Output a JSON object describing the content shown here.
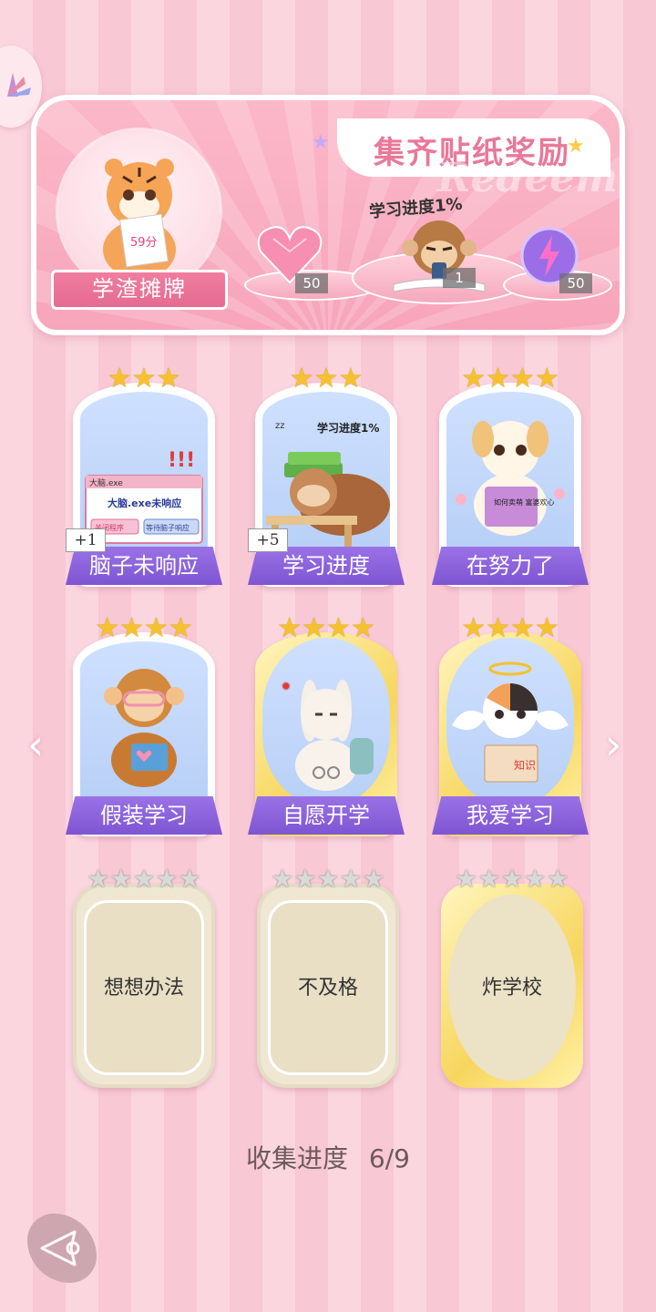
{
  "banner": {
    "title": "集齐贴纸奖励",
    "watermark": "Redeem",
    "ribbon_label": "学渣摊牌",
    "tiger_sign": "59分",
    "progress_tag": "学习进度1%",
    "rewards": [
      {
        "name": "heart-gem",
        "count": "50"
      },
      {
        "name": "monkey-sticker",
        "count": "1"
      },
      {
        "name": "lightning-orb",
        "count": "50"
      }
    ]
  },
  "cards": [
    {
      "label": "脑子未响应",
      "stars": "★★★",
      "badge": "+1",
      "art": "brain-window"
    },
    {
      "label": "学习进度",
      "stars": "★★★",
      "badge": "+5",
      "art": "sleeping-sloth"
    },
    {
      "label": "在努力了",
      "stars": "★★★★",
      "badge": "",
      "art": "reading-puppy"
    },
    {
      "label": "假装学习",
      "stars": "★★★★",
      "badge": "",
      "art": "reading-monkey"
    },
    {
      "label": "自愿开学",
      "stars": "★★★★",
      "badge": "",
      "art": "bunny-handcuffs"
    },
    {
      "label": "我爱学习",
      "stars": "★★★★",
      "badge": "",
      "art": "angel-cat"
    }
  ],
  "locked_cards": [
    {
      "label": "想想办法",
      "stars": "★★★★★"
    },
    {
      "label": "不及格",
      "stars": "★★★★★"
    },
    {
      "label": "炸学校",
      "stars": "★★★★★"
    }
  ],
  "art_text": {
    "window_title": "大脑.exe",
    "window_msg": "大脑.exe未响应",
    "btn_close": "关闭程序",
    "btn_wait": "等待脑子响应",
    "sloth_tag": "学习进度1%",
    "puppy_book": "如何卖萌 富婆欢心",
    "cat_book": "知识"
  },
  "progress": {
    "label": "收集进度",
    "value": "6/9"
  },
  "colors": {
    "accent_pink": "#e97899",
    "label_purple": "#8a62dc",
    "gold": "#f7d65e"
  }
}
